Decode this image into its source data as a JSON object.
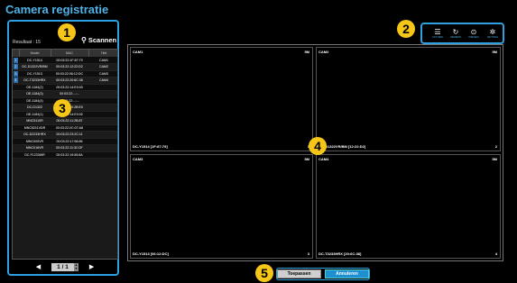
{
  "title": "Camera registratie",
  "left_panel": {
    "result_label": "Resultaat : 15",
    "scan_label": "Scannen",
    "columns": [
      "",
      "Model",
      "MAC",
      "Titel"
    ],
    "rows": [
      {
        "idx": "1",
        "model": "DC-Y1514",
        "mac": "00:03:22:1F:87:79",
        "title": "CAM1"
      },
      {
        "idx": "2",
        "model": "DC-D1322VR/BM",
        "mac": "00:03:22:12:22:D2",
        "title": "CAM2"
      },
      {
        "idx": "3",
        "model": "DC-Y1513",
        "mac": "00:03:22:06:12:DC",
        "title": "CAM3"
      },
      {
        "idx": "4",
        "model": "DC-T3233HRX",
        "mac": "00:03:22:20:6C:38",
        "title": "CAM4"
      },
      {
        "idx": "",
        "model": "DE-1184(2)",
        "mac": "00:03:22:14:E0:00",
        "title": ""
      },
      {
        "idx": "",
        "model": "DE-1184(3)",
        "mac": "00:03:22:...:...",
        "title": ""
      },
      {
        "idx": "",
        "model": "DE-1184(4)",
        "mac": "00:03:22:...:...",
        "title": ""
      },
      {
        "idx": "",
        "model": "DC-D1322",
        "mac": "00:03:22:10:2B:E0",
        "title": ""
      },
      {
        "idx": "",
        "model": "DE-1184(1)",
        "mac": "00:03:22:14:E0:02",
        "title": ""
      },
      {
        "idx": "",
        "model": "MNC5110R",
        "mac": "00:03:22:11:2B:87",
        "title": ""
      },
      {
        "idx": "",
        "model": "MNC5211VDR",
        "mac": "00:03:22:2C:07:A8",
        "title": ""
      },
      {
        "idx": "",
        "model": "DC-D2233HRX",
        "mac": "00:03:22:23:2C:11",
        "title": ""
      },
      {
        "idx": "",
        "model": "MNC005VR",
        "mac": "00:03:22:17:56:86",
        "title": ""
      },
      {
        "idx": "",
        "model": "MNC016VR",
        "mac": "00:03:22:11:3C:0F",
        "title": ""
      },
      {
        "idx": "",
        "model": "DC-F1233WR",
        "mac": "00:03:22:19:55:8A",
        "title": ""
      }
    ],
    "pager": {
      "page": "1 / 1"
    }
  },
  "toolbar": [
    {
      "icon": "list-icon",
      "glyph": "☰",
      "caption": "LIST VIEW"
    },
    {
      "icon": "refresh-icon",
      "glyph": "↻",
      "caption": "REFRESH"
    },
    {
      "icon": "play-icon",
      "glyph": "⊙",
      "caption": "PREVIEW"
    },
    {
      "icon": "gear-icon",
      "glyph": "✲",
      "caption": "SETTINGS"
    }
  ],
  "cameras": [
    {
      "name": "CAM1",
      "res": "5M",
      "model": "DC-Y1514 [1F:87:79]",
      "ch": "1"
    },
    {
      "name": "CAM2",
      "res": "5M",
      "model": "DC-D1322VR/BM [12:22:D2]",
      "ch": "2"
    },
    {
      "name": "CAM3",
      "res": "5M",
      "model": "DC-Y1513 [06:12:DC]",
      "ch": "3"
    },
    {
      "name": "CAM4",
      "res": "5M",
      "model": "DC-T3233HRX [20:6C:38]",
      "ch": "4"
    }
  ],
  "buttons": {
    "apply": "Toepassen",
    "cancel": "Annuleren"
  },
  "callouts": [
    "1",
    "2",
    "3",
    "4",
    "5"
  ],
  "colors": {
    "accent": "#2fa0e0",
    "badge": "#f5c518",
    "title": "#4fb3e8",
    "cancel_btn": "#1e8fd0"
  }
}
